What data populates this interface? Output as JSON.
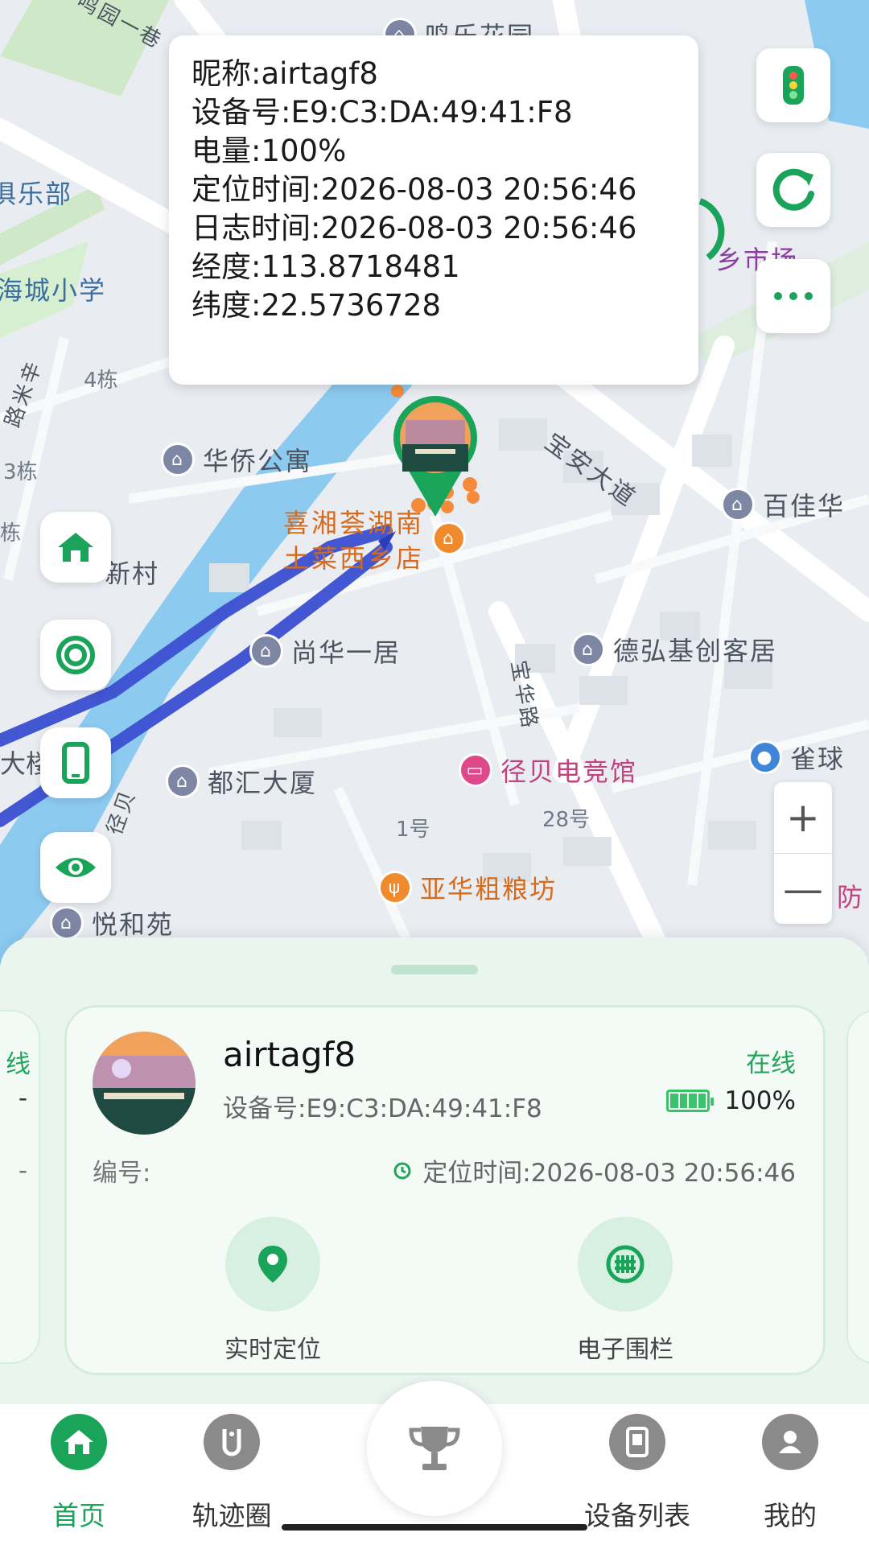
{
  "map": {
    "pois": {
      "top_garden": "鸣乐花园",
      "club": "俱乐部",
      "school": "海城小学",
      "market": "乡市场",
      "huaqiao": "华侨公寓",
      "baijia": "百佳华",
      "restaurant": "喜湘荟湖南土菜西乡店",
      "restaurant_line1": "喜湘荟湖南",
      "restaurant_line2": "土菜西乡店",
      "xincun": "新村",
      "shanghua": "尚华一居",
      "dehong": "德弘基创客居",
      "duhui": "都汇大厦",
      "jingbei": "径贝电竞馆",
      "queqiu": "雀球",
      "yahua": "亚华粗粮坊",
      "yuehe": "悦和苑",
      "fang": "防"
    },
    "streets": {
      "baoan": "宝安大道",
      "yixiang": "鸣园一巷",
      "daoxiang": "宝华路",
      "jingbei_road": "径贝",
      "left_road": "路米辛"
    },
    "labels": {
      "b4": "4栋",
      "b3": "3栋",
      "b_left": "栋",
      "da": "大楼",
      "no1": "1号",
      "no28": "28号"
    },
    "zoom_in": "+",
    "zoom_out": "—"
  },
  "info_popup": {
    "nickname": "昵称:airtagf8",
    "device_no": "设备号:E9:C3:DA:49:41:F8",
    "battery": "电量:100%",
    "locate_time": "定位时间:2026-08-03 20:56:46",
    "log_time": "日志时间:2026-08-03 20:56:46",
    "longitude": "经度:113.8718481",
    "latitude": "纬度:22.5736728"
  },
  "device_card": {
    "name": "airtagf8",
    "device_no": "设备号:E9:C3:DA:49:41:F8",
    "status": "在线",
    "battery": "100%",
    "battery_level": 1.0,
    "number_label": "编号:",
    "locate_time": "定位时间:2026-08-03 20:56:46",
    "actions": [
      {
        "label": "实时定位",
        "icon": "location-pin-icon"
      },
      {
        "label": "电子围栏",
        "icon": "fence-icon"
      }
    ],
    "left_peek": {
      "status": "线",
      "line1": "-",
      "line2": "-"
    }
  },
  "tabs": [
    {
      "label": "首页",
      "icon": "home-icon",
      "active": true
    },
    {
      "label": "轨迹圈",
      "icon": "track-icon",
      "active": false
    },
    {
      "label": "",
      "icon": "trophy-icon",
      "active": false
    },
    {
      "label": "设备列表",
      "icon": "device-list-icon",
      "active": false
    },
    {
      "label": "我的",
      "icon": "profile-icon",
      "active": false
    }
  ],
  "colors": {
    "accent": "#1aa45a",
    "route": "#3c4fd1",
    "water": "#7fc3ef"
  }
}
